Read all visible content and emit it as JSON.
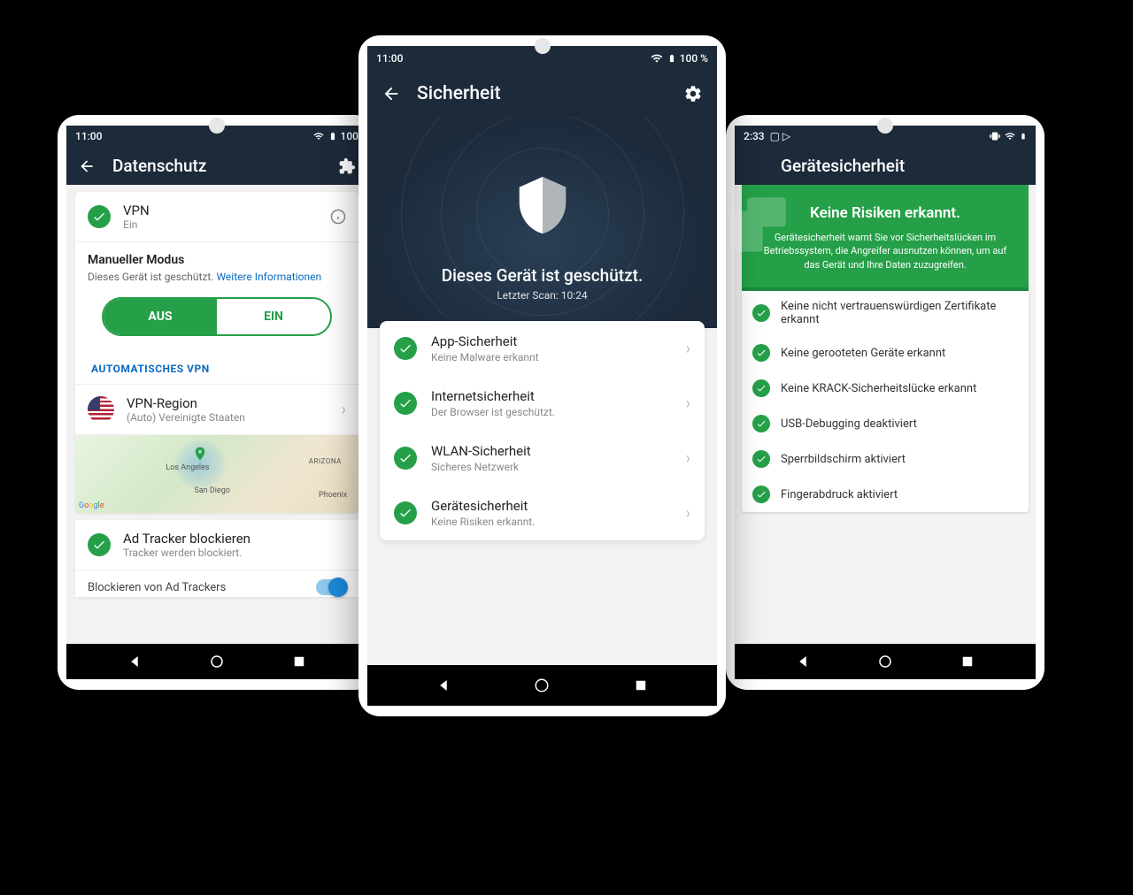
{
  "left": {
    "status": {
      "time": "11:00",
      "battery": "100"
    },
    "header": {
      "title": "Datenschutz"
    },
    "vpn": {
      "title": "VPN",
      "status": "Ein"
    },
    "manual": {
      "title": "Manueller Modus",
      "desc": "Dieses Gerät ist geschützt.",
      "link": "Weitere Informationen"
    },
    "toggle": {
      "off": "AUS",
      "on": "EIN"
    },
    "autovpn_label": "AUTOMATISCHES VPN",
    "region": {
      "title": "VPN-Region",
      "value": "(Auto) Vereinigte Staaten"
    },
    "map": {
      "attrib": "Google",
      "city_la": "Los Angeles",
      "city_sd": "San Diego",
      "city_az": "ARIZONA",
      "city_ph": "Phoenix"
    },
    "tracker": {
      "title": "Ad Tracker blockieren",
      "sub": "Tracker werden blockiert."
    },
    "block_label": "Blockieren von Ad Trackers"
  },
  "center": {
    "status": {
      "time": "11:00",
      "battery": "100 %"
    },
    "header": {
      "title": "Sicherheit"
    },
    "hero": {
      "title": "Dieses Gerät ist geschützt.",
      "sub": "Letzter Scan: 10:24"
    },
    "items": [
      {
        "title": "App-Sicherheit",
        "sub": "Keine Malware erkannt"
      },
      {
        "title": "Internetsicherheit",
        "sub": "Der Browser ist geschützt."
      },
      {
        "title": "WLAN-Sicherheit",
        "sub": "Sicheres Netzwerk"
      },
      {
        "title": "Gerätesicherheit",
        "sub": "Keine Risiken erkannt."
      }
    ]
  },
  "right": {
    "status": {
      "time": "2:33"
    },
    "header": {
      "title": "Gerätesicherheit"
    },
    "banner": {
      "title": "Keine Risiken erkannt.",
      "desc": "Gerätesicherheit warnt Sie vor Sicherheitslücken im Betriebssystem, die Angreifer ausnutzen können, um auf das Gerät und Ihre Daten zuzugreifen."
    },
    "risks": [
      "Keine nicht vertrauenswürdigen Zertifikate erkannt",
      "Keine gerooteten Geräte erkannt",
      "Keine KRACK-Sicherheitslücke erkannt",
      "USB-Debugging deaktiviert",
      "Sperrbildschirm aktiviert",
      "Fingerabdruck aktiviert"
    ]
  }
}
